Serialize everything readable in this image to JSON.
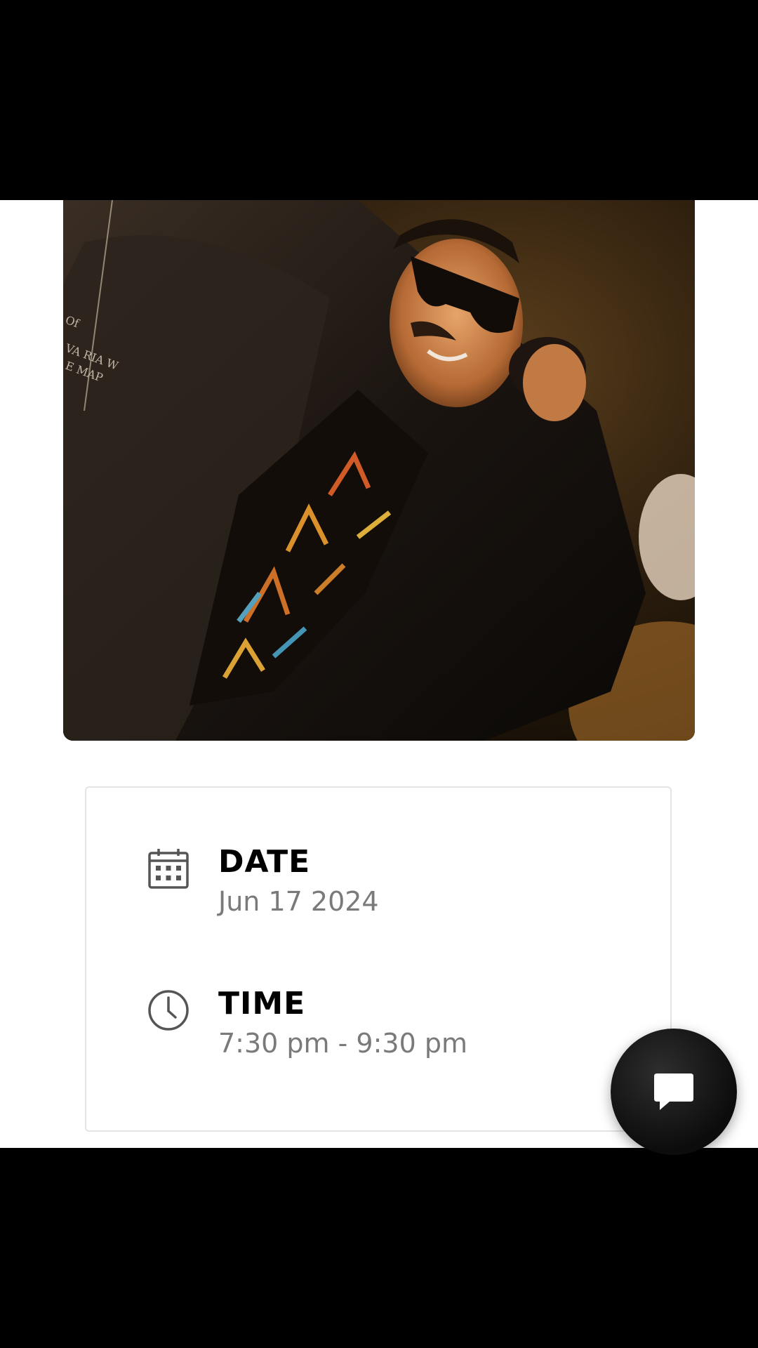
{
  "event": {
    "date_label": "DATE",
    "date_value": "Jun 17 2024",
    "time_label": "TIME",
    "time_value": "7:30 pm - 9:30 pm"
  },
  "icons": {
    "date": "calendar-icon",
    "time": "clock-icon",
    "chat": "chat-bubble-icon"
  },
  "colors": {
    "background": "#000000",
    "surface": "#ffffff",
    "label": "#000000",
    "value": "#7a7a7a",
    "icon": "#555555",
    "fab": "#111111"
  }
}
